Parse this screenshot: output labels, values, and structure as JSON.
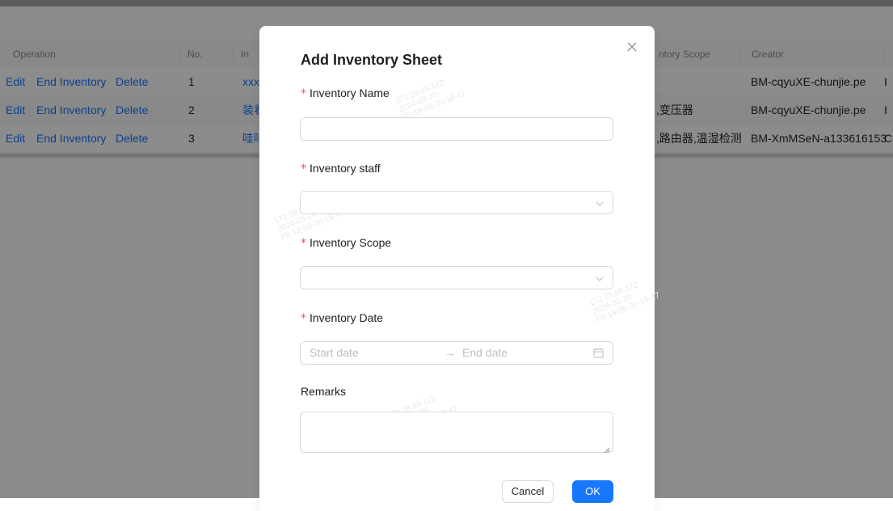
{
  "table": {
    "headers": {
      "operation": "Operation",
      "no": "No.",
      "name": "In",
      "scope": "ntory Scope",
      "creator": "Creator"
    },
    "rows": [
      {
        "edit": "Edit",
        "end": "End Inventory",
        "delete": "Delete",
        "no": "1",
        "name": "xxx",
        "scope": "",
        "creator": "BM-cqyuXE-chunjie.pe",
        "extra": "I"
      },
      {
        "edit": "Edit",
        "end": "End Inventory",
        "delete": "Delete",
        "no": "2",
        "name": "装看",
        "scope": ",变压器",
        "creator": "BM-cqyuXE-chunjie.pe",
        "extra": "I"
      },
      {
        "edit": "Edit",
        "end": "End Inventory",
        "delete": "Delete",
        "no": "3",
        "name": "哇哇",
        "scope": ",路由器,温湿检测",
        "creator": "BM-XmMSeN-a133616153",
        "extra": "C"
      }
    ]
  },
  "modal": {
    "title": "Add Inventory Sheet",
    "fields": {
      "name": {
        "label": "Inventory Name",
        "value": ""
      },
      "staff": {
        "label": "Inventory staff",
        "value": ""
      },
      "scope": {
        "label": "Inventory Scope",
        "value": ""
      },
      "date": {
        "label": "Inventory Date",
        "start_placeholder": "Start date",
        "end_placeholder": "End date",
        "arrow": "→"
      },
      "remarks": {
        "label": "Remarks",
        "value": ""
      }
    },
    "required_mark": "*",
    "cancel_label": "Cancel",
    "ok_label": "OK"
  },
  "watermark": [
    "172.28.89.122",
    "2024-03-20",
    "F0-18-98-30-18-47"
  ],
  "colors": {
    "accent": "#1677ff",
    "required": "#ff4d4f"
  },
  "icons": [
    "close-icon",
    "chevron-down-icon",
    "calendar-icon",
    "resize-handle-icon"
  ]
}
